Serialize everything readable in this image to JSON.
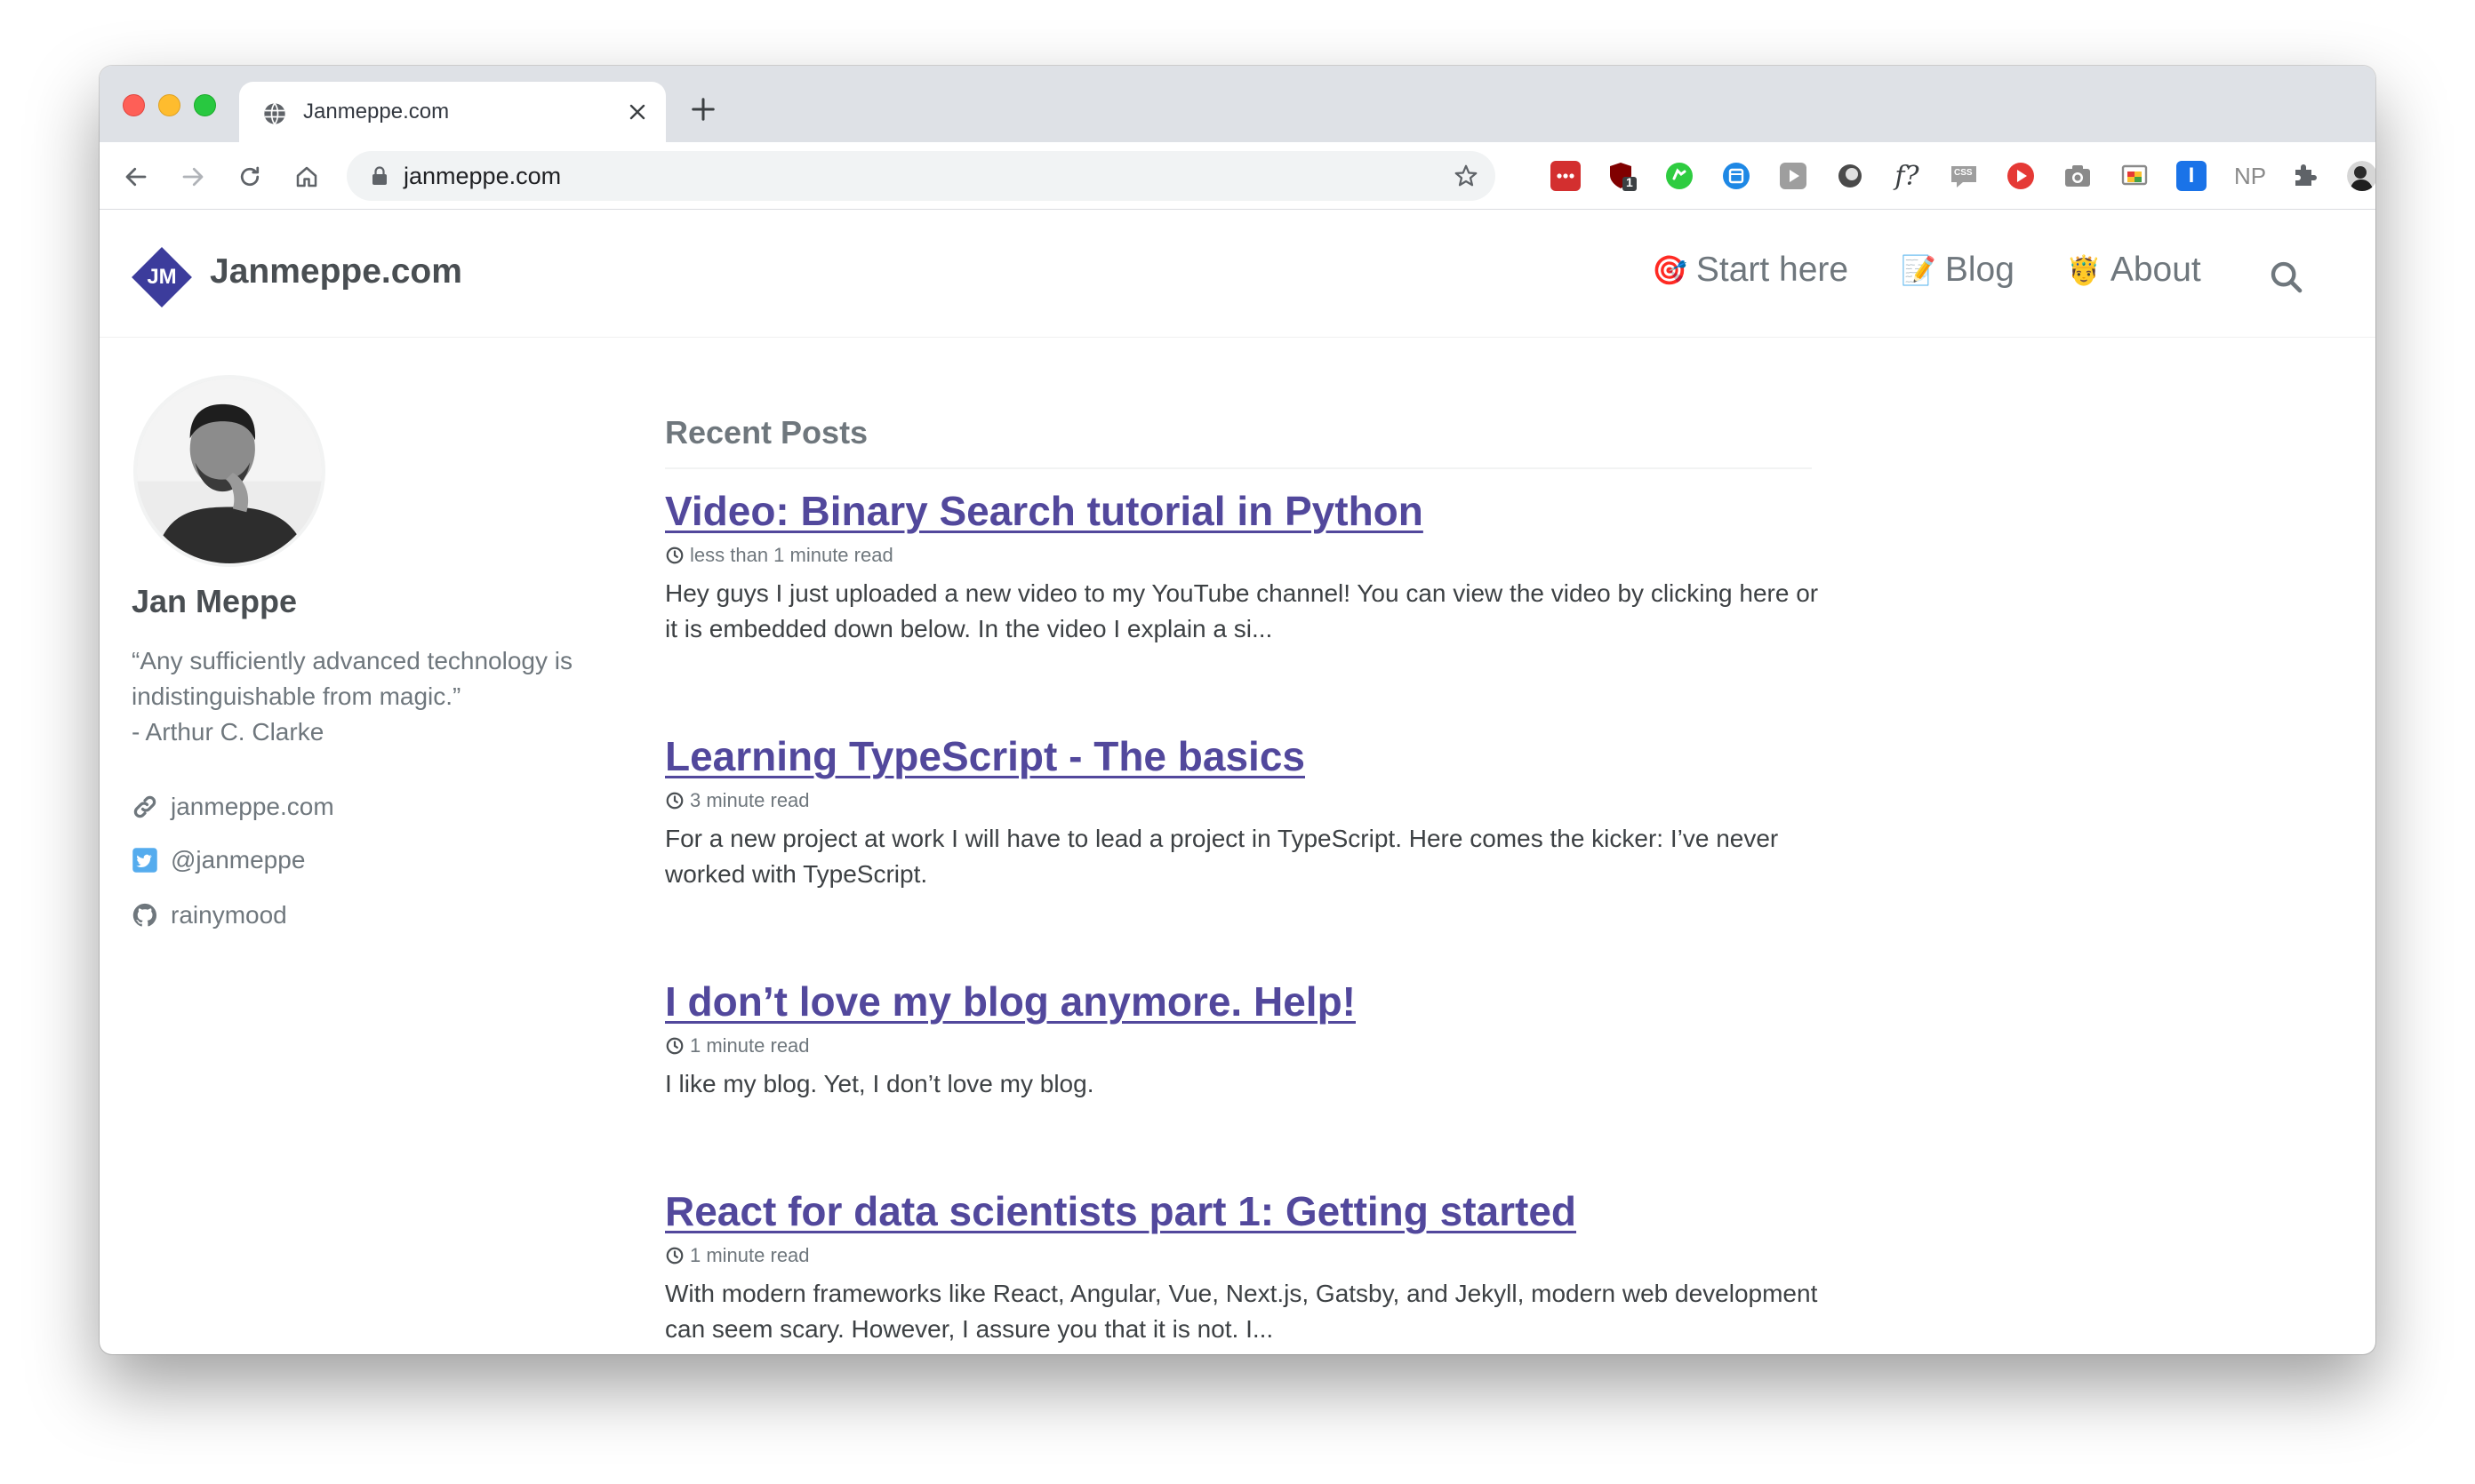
{
  "browser": {
    "tab_title": "Janmeppe.com",
    "url": "janmeppe.com",
    "extensions": [
      "lastpass-icon",
      "ublock-icon",
      "green-extension-icon",
      "blue-extension-icon",
      "play-icon",
      "circle-extension-icon",
      "whatfont-icon",
      "css-extension-icon",
      "youtube-icon",
      "camera-icon",
      "cast-icon",
      "info-extension-icon",
      "np-extension-icon",
      "puzzle-icon",
      "profile-avatar",
      "menu-dots-icon"
    ],
    "ublock_badge": "1",
    "whatfont_label": "f?",
    "np_label": "NP",
    "css_label": "CSS",
    "info_label": "I"
  },
  "site": {
    "brand": "Janmeppe.com",
    "logo_text": "JM",
    "logo_color": "#3c3c9c",
    "accent": "#52489c",
    "nav": [
      {
        "emoji": "🎯",
        "label": "Start here"
      },
      {
        "emoji": "📝",
        "label": "Blog"
      },
      {
        "emoji": "🤴",
        "label": "About"
      }
    ]
  },
  "author": {
    "name": "Jan Meppe",
    "bio_line1": "“Any sufficiently advanced technology is",
    "bio_line2": "indistinguishable from magic.”",
    "bio_line3": "- Arthur C. Clarke",
    "links": [
      {
        "icon": "link-icon",
        "label": "janmeppe.com"
      },
      {
        "icon": "twitter-icon",
        "label": "@janmeppe"
      },
      {
        "icon": "github-icon",
        "label": "rainymood"
      }
    ]
  },
  "main": {
    "section_title": "Recent Posts",
    "posts": [
      {
        "title": "Video: Binary Search tutorial in Python",
        "meta": "less than 1 minute read",
        "excerpt": "Hey guys I just uploaded a new video to my YouTube channel! You can view the video by clicking here or it is embedded down below. In the video I explain a si..."
      },
      {
        "title": "Learning TypeScript - The basics",
        "meta": "3 minute read",
        "excerpt": "For a new project at work I will have to lead a project in TypeScript. Here comes the kicker: I’ve never worked with TypeScript."
      },
      {
        "title": "I don’t love my blog anymore. Help!",
        "meta": "1 minute read",
        "excerpt": "I like my blog. Yet, I don’t love my blog."
      },
      {
        "title": "React for data scientists part 1: Getting started",
        "meta": "1 minute read",
        "excerpt": "With modern frameworks like React, Angular, Vue, Next.js, Gatsby, and Jekyll, modern web development can seem scary. However, I assure you that it is not. I..."
      }
    ]
  }
}
